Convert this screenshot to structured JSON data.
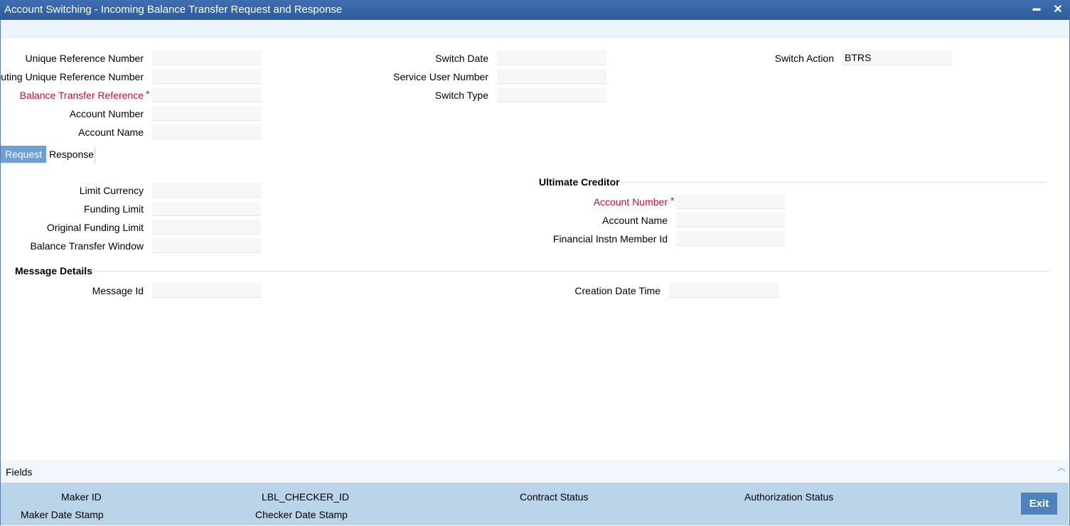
{
  "window": {
    "title": "Account Switching - Incoming Balance Transfer Request and Response",
    "minimize_glyph": "▬",
    "close_glyph": "✕"
  },
  "header_fields": {
    "unique_ref_label": "Unique Reference Number",
    "routing_ref_label": "Routing Unique Reference Number",
    "balance_transfer_ref_label": "Balance Transfer Reference",
    "account_number_label": "Account Number",
    "account_name_label": "Account Name",
    "switch_date_label": "Switch Date",
    "service_user_number_label": "Service User Number",
    "switch_type_label": "Switch Type",
    "switch_action_label": "Switch Action",
    "switch_action_value": "BTRS",
    "required_mark": "*"
  },
  "tabs": [
    {
      "label": "Request",
      "active": true
    },
    {
      "label": "Response",
      "active": false
    }
  ],
  "request": {
    "limit_currency_label": "Limit Currency",
    "funding_limit_label": "Funding Limit",
    "original_funding_limit_label": "Original Funding Limit",
    "balance_transfer_window_label": "Balance Transfer Window",
    "ultimate_creditor": {
      "heading": "Ultimate Creditor",
      "account_number_label": "Account Number",
      "account_name_label": "Account Name",
      "fin_instn_member_id_label": "Financial Instn Member Id"
    },
    "message_details": {
      "heading": "Message Details",
      "message_id_label": "Message Id",
      "creation_date_time_label": "Creation Date Time"
    }
  },
  "fields_bar": {
    "label": "Fields",
    "collapse_glyph": "︿"
  },
  "footer": {
    "maker_id_label": "Maker ID",
    "maker_date_stamp_label": "Maker Date Stamp",
    "checker_id_label": "LBL_CHECKER_ID",
    "checker_date_stamp_label": "Checker Date Stamp",
    "contract_status_label": "Contract Status",
    "authorization_status_label": "Authorization Status",
    "exit_label": "Exit"
  },
  "colors": {
    "title_bar": "#2c5b9e",
    "required_label": "#c8102e",
    "active_tab": "#6e9fd6",
    "footer_bg": "#bad4ea",
    "exit_button": "#4f81bd"
  }
}
